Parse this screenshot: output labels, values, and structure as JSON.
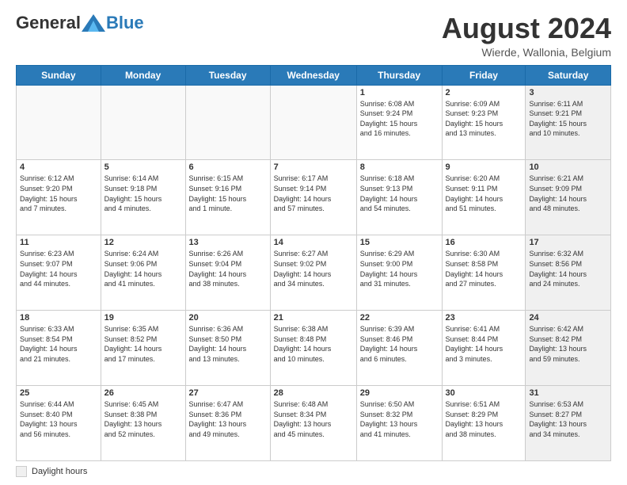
{
  "header": {
    "logo_general": "General",
    "logo_blue": "Blue",
    "month_title": "August 2024",
    "subtitle": "Wierde, Wallonia, Belgium"
  },
  "days_of_week": [
    "Sunday",
    "Monday",
    "Tuesday",
    "Wednesday",
    "Thursday",
    "Friday",
    "Saturday"
  ],
  "footer": {
    "legend_label": "Daylight hours"
  },
  "weeks": [
    [
      {
        "day": "",
        "info": ""
      },
      {
        "day": "",
        "info": ""
      },
      {
        "day": "",
        "info": ""
      },
      {
        "day": "",
        "info": ""
      },
      {
        "day": "1",
        "info": "Sunrise: 6:08 AM\nSunset: 9:24 PM\nDaylight: 15 hours\nand 16 minutes."
      },
      {
        "day": "2",
        "info": "Sunrise: 6:09 AM\nSunset: 9:23 PM\nDaylight: 15 hours\nand 13 minutes."
      },
      {
        "day": "3",
        "info": "Sunrise: 6:11 AM\nSunset: 9:21 PM\nDaylight: 15 hours\nand 10 minutes."
      }
    ],
    [
      {
        "day": "4",
        "info": "Sunrise: 6:12 AM\nSunset: 9:20 PM\nDaylight: 15 hours\nand 7 minutes."
      },
      {
        "day": "5",
        "info": "Sunrise: 6:14 AM\nSunset: 9:18 PM\nDaylight: 15 hours\nand 4 minutes."
      },
      {
        "day": "6",
        "info": "Sunrise: 6:15 AM\nSunset: 9:16 PM\nDaylight: 15 hours\nand 1 minute."
      },
      {
        "day": "7",
        "info": "Sunrise: 6:17 AM\nSunset: 9:14 PM\nDaylight: 14 hours\nand 57 minutes."
      },
      {
        "day": "8",
        "info": "Sunrise: 6:18 AM\nSunset: 9:13 PM\nDaylight: 14 hours\nand 54 minutes."
      },
      {
        "day": "9",
        "info": "Sunrise: 6:20 AM\nSunset: 9:11 PM\nDaylight: 14 hours\nand 51 minutes."
      },
      {
        "day": "10",
        "info": "Sunrise: 6:21 AM\nSunset: 9:09 PM\nDaylight: 14 hours\nand 48 minutes."
      }
    ],
    [
      {
        "day": "11",
        "info": "Sunrise: 6:23 AM\nSunset: 9:07 PM\nDaylight: 14 hours\nand 44 minutes."
      },
      {
        "day": "12",
        "info": "Sunrise: 6:24 AM\nSunset: 9:06 PM\nDaylight: 14 hours\nand 41 minutes."
      },
      {
        "day": "13",
        "info": "Sunrise: 6:26 AM\nSunset: 9:04 PM\nDaylight: 14 hours\nand 38 minutes."
      },
      {
        "day": "14",
        "info": "Sunrise: 6:27 AM\nSunset: 9:02 PM\nDaylight: 14 hours\nand 34 minutes."
      },
      {
        "day": "15",
        "info": "Sunrise: 6:29 AM\nSunset: 9:00 PM\nDaylight: 14 hours\nand 31 minutes."
      },
      {
        "day": "16",
        "info": "Sunrise: 6:30 AM\nSunset: 8:58 PM\nDaylight: 14 hours\nand 27 minutes."
      },
      {
        "day": "17",
        "info": "Sunrise: 6:32 AM\nSunset: 8:56 PM\nDaylight: 14 hours\nand 24 minutes."
      }
    ],
    [
      {
        "day": "18",
        "info": "Sunrise: 6:33 AM\nSunset: 8:54 PM\nDaylight: 14 hours\nand 21 minutes."
      },
      {
        "day": "19",
        "info": "Sunrise: 6:35 AM\nSunset: 8:52 PM\nDaylight: 14 hours\nand 17 minutes."
      },
      {
        "day": "20",
        "info": "Sunrise: 6:36 AM\nSunset: 8:50 PM\nDaylight: 14 hours\nand 13 minutes."
      },
      {
        "day": "21",
        "info": "Sunrise: 6:38 AM\nSunset: 8:48 PM\nDaylight: 14 hours\nand 10 minutes."
      },
      {
        "day": "22",
        "info": "Sunrise: 6:39 AM\nSunset: 8:46 PM\nDaylight: 14 hours\nand 6 minutes."
      },
      {
        "day": "23",
        "info": "Sunrise: 6:41 AM\nSunset: 8:44 PM\nDaylight: 14 hours\nand 3 minutes."
      },
      {
        "day": "24",
        "info": "Sunrise: 6:42 AM\nSunset: 8:42 PM\nDaylight: 13 hours\nand 59 minutes."
      }
    ],
    [
      {
        "day": "25",
        "info": "Sunrise: 6:44 AM\nSunset: 8:40 PM\nDaylight: 13 hours\nand 56 minutes."
      },
      {
        "day": "26",
        "info": "Sunrise: 6:45 AM\nSunset: 8:38 PM\nDaylight: 13 hours\nand 52 minutes."
      },
      {
        "day": "27",
        "info": "Sunrise: 6:47 AM\nSunset: 8:36 PM\nDaylight: 13 hours\nand 49 minutes."
      },
      {
        "day": "28",
        "info": "Sunrise: 6:48 AM\nSunset: 8:34 PM\nDaylight: 13 hours\nand 45 minutes."
      },
      {
        "day": "29",
        "info": "Sunrise: 6:50 AM\nSunset: 8:32 PM\nDaylight: 13 hours\nand 41 minutes."
      },
      {
        "day": "30",
        "info": "Sunrise: 6:51 AM\nSunset: 8:29 PM\nDaylight: 13 hours\nand 38 minutes."
      },
      {
        "day": "31",
        "info": "Sunrise: 6:53 AM\nSunset: 8:27 PM\nDaylight: 13 hours\nand 34 minutes."
      }
    ]
  ]
}
